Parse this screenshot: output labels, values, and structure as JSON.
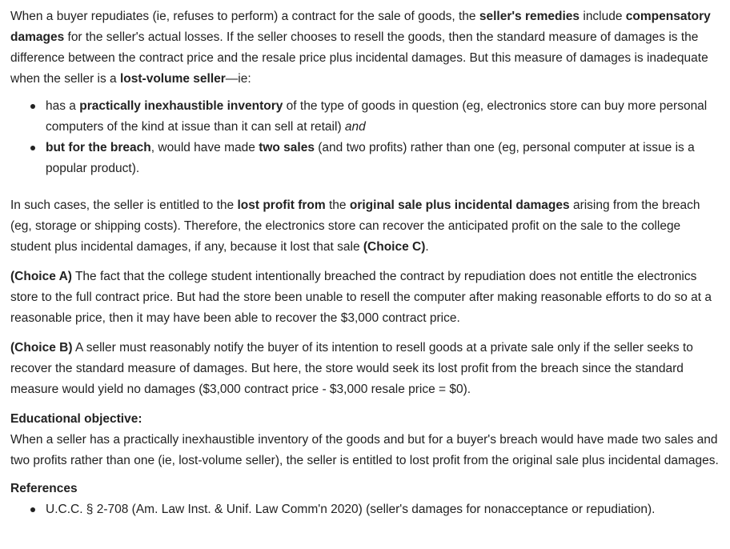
{
  "intro": {
    "t1": "When a buyer repudiates (ie, refuses to perform) a contract for the sale of goods, the ",
    "b1": "seller's remedies",
    "t2": " include ",
    "b2": "compensatory damages",
    "t3": " for the seller's actual losses.  If the seller chooses to resell the goods, then the standard measure of damages is the difference between the contract price and the resale price plus incidental damages.  But this measure of damages is inadequate when the seller is a ",
    "b3": "lost-volume seller",
    "t4": "—ie:"
  },
  "bullets": [
    {
      "t1": "has a ",
      "b1": "practically inexhaustible inventory",
      "t2": " of the type of goods in question (eg, electronics store can buy more personal computers of the kind at issue than it can sell at retail) ",
      "i1": "and"
    },
    {
      "b1": "but for the breach",
      "t1": ", would have made ",
      "b2": "two sales",
      "t2": " (and two profits) rather than one (eg, personal computer at issue is a popular product)."
    }
  ],
  "cases": {
    "t1": "In such cases, the seller is entitled to the ",
    "b1": "lost profit from",
    "t2": " the ",
    "b2": "original sale plus incidental damages",
    "t3": " arising from the breach (eg, storage or shipping costs).  Therefore, the electronics store can recover the anticipated profit on the sale to the college student plus incidental damages, if any, because it lost that sale ",
    "b3": "(Choice C)",
    "t4": "."
  },
  "choice_a": {
    "label": "(Choice A)",
    "text": "  The fact that the college student intentionally breached the contract by repudiation does not entitle the electronics store to the full contract price.  But had the store been unable to resell the computer after making reasonable efforts to do so at a reasonable price, then it may have been able to recover the $3,000 contract price."
  },
  "choice_b": {
    "label": "(Choice B)",
    "text": "  A seller must reasonably notify the buyer of its intention to resell goods at a private sale only if the seller seeks to recover the standard measure of damages.  But here, the store would seek its lost profit from the breach since the standard measure would yield no damages ($3,000 contract price - $3,000 resale price = $0)."
  },
  "educational": {
    "heading": "Educational objective:",
    "body": "When a seller has a practically inexhaustible inventory of the goods and but for a buyer's breach would have made two sales and two profits rather than one (ie, lost-volume seller), the seller is entitled to lost profit from the original sale plus incidental damages."
  },
  "references": {
    "heading": "References",
    "items": [
      "U.C.C. § 2-708 (Am. Law Inst. & Unif. Law Comm'n 2020) (seller's damages for nonacceptance or repudiation)."
    ]
  }
}
